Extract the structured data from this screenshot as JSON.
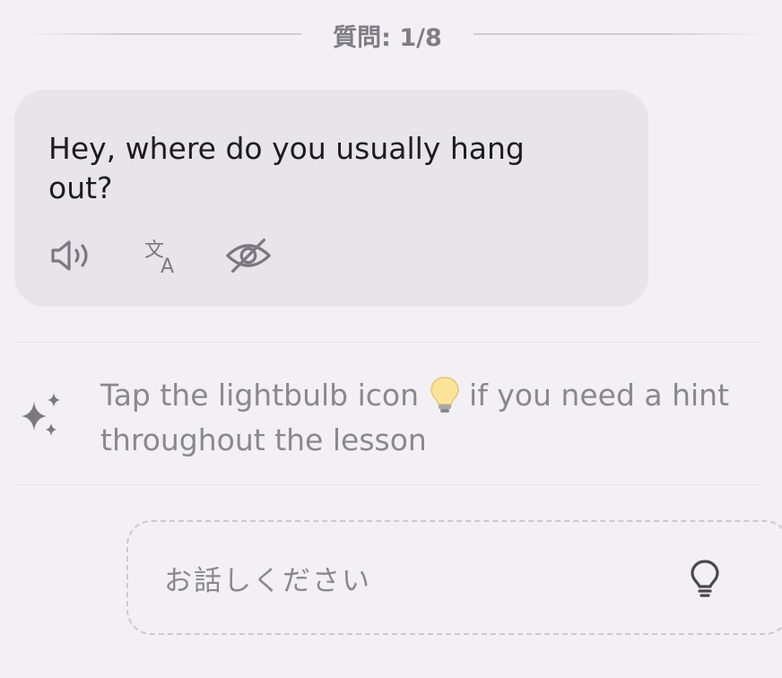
{
  "progress": {
    "label": "質問: 1/8",
    "current": 1,
    "total": 8
  },
  "message": {
    "text": "Hey, where do you usually hang out?",
    "actions": [
      "speaker-icon",
      "translate-icon",
      "eye-off-icon"
    ]
  },
  "hint": {
    "text_before": "Tap the lightbulb icon",
    "text_after": "if you need a hint throughout the lesson",
    "icon": "sparkles-icon"
  },
  "reply": {
    "placeholder": "お話しください",
    "hint_button_icon": "lightbulb-icon"
  },
  "colors": {
    "background": "#f2f0f5",
    "bubble": "#e7e5ea",
    "text_primary": "#1c1c1e",
    "text_muted": "#8a888f"
  }
}
